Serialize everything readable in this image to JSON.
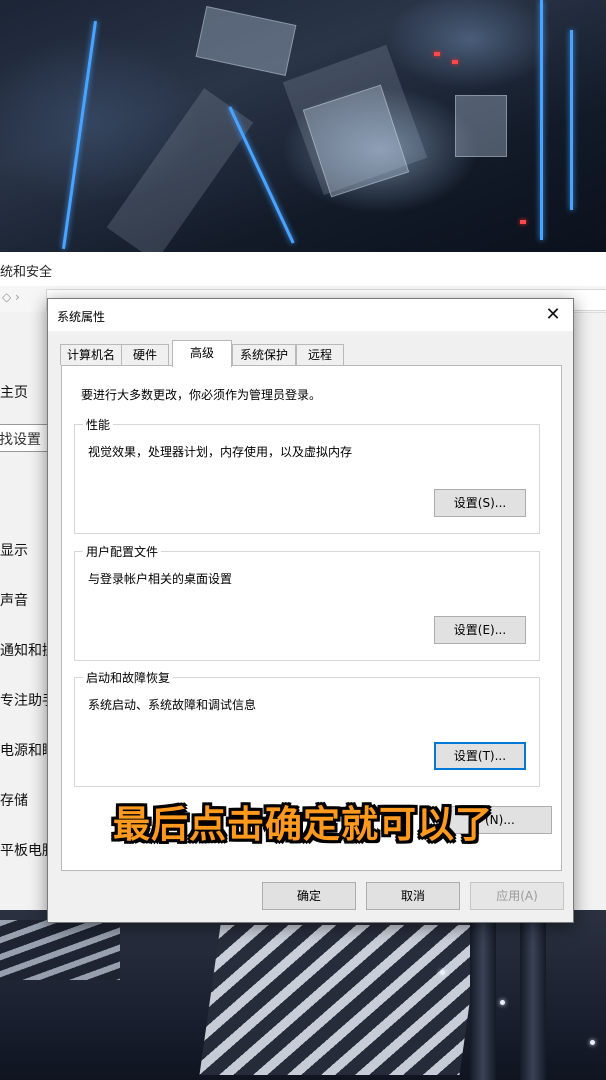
{
  "background_settings": {
    "title_fragment": "统和安全",
    "sidebar": {
      "home_fragment": "主页",
      "search_fragment": "找设置",
      "items": [
        "显示",
        "声音",
        "通知和操",
        "专注助手",
        "电源和睡",
        "存储",
        "平板电脑"
      ]
    }
  },
  "dialog": {
    "title": "系统属性",
    "close_glyph": "✕",
    "tabs": [
      {
        "label": "计算机名"
      },
      {
        "label": "硬件"
      },
      {
        "label": "高级"
      },
      {
        "label": "系统保护"
      },
      {
        "label": "远程"
      }
    ],
    "active_tab": "高级",
    "admin_note": "要进行大多数更改，你必须作为管理员登录。",
    "groups": {
      "performance": {
        "legend": "性能",
        "description": "视觉效果，处理器计划，内存使用，以及虚拟内存",
        "button": "设置(S)..."
      },
      "user_profiles": {
        "legend": "用户配置文件",
        "description": "与登录帐户相关的桌面设置",
        "button": "设置(E)..."
      },
      "startup_recovery": {
        "legend": "启动和故障恢复",
        "description": "系统启动、系统故障和调试信息",
        "button": "设置(T)..."
      }
    },
    "env_button_fragment": "(N)...",
    "footer": {
      "ok": "确定",
      "cancel": "取消",
      "apply": "应用(A)"
    }
  },
  "caption": "最后点击确定就可以了",
  "colors": {
    "caption_fill": "#ff9a1f",
    "focus_border": "#0078d7"
  }
}
